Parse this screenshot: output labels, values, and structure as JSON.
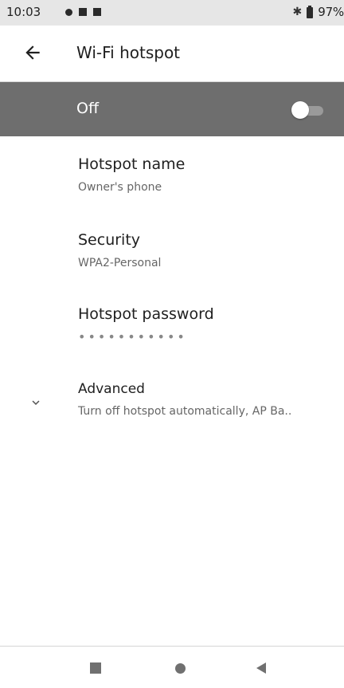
{
  "status_bar": {
    "time": "10:03",
    "battery": "97%",
    "icons": [
      "notification-dot-icon",
      "square-icon",
      "square-icon",
      "bluetooth-icon",
      "battery-icon"
    ]
  },
  "app_bar": {
    "title": "Wi-Fi hotspot",
    "back_icon": "arrow-left-icon"
  },
  "master_switch": {
    "label": "Off",
    "state": false
  },
  "settings": [
    {
      "title": "Hotspot name",
      "summary": "Owner's phone"
    },
    {
      "title": "Security",
      "summary": "WPA2-Personal"
    },
    {
      "title": "Hotspot password",
      "summary": "•••••••••••"
    },
    {
      "title": "Advanced",
      "summary": "Turn off hotspot automatically, AP Ba..",
      "icon": "chevron-down-icon"
    }
  ],
  "nav_bar": {
    "icons": [
      "recents-square-icon",
      "home-circle-icon",
      "back-triangle-icon"
    ]
  },
  "colors": {
    "status_bar_bg": "#e6e6e6",
    "switch_bar_bg": "#6e6e6e",
    "switch_text": "#ffffff",
    "primary_text": "#202020",
    "secondary_text": "#666666"
  }
}
